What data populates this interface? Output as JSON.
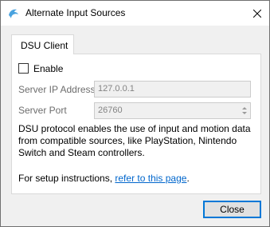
{
  "window": {
    "title": "Alternate Input Sources",
    "app_icon": "dolphin-icon",
    "close_icon": "close-icon"
  },
  "tabs": [
    {
      "label": "DSU Client",
      "active": true
    }
  ],
  "dsu": {
    "enable_label": "Enable",
    "enable_checked": false,
    "server_ip_label": "Server IP Address",
    "server_ip_value": "127.0.0.1",
    "server_port_label": "Server Port",
    "server_port_value": "26760",
    "description": "DSU protocol enables the use of input and motion data from compatible sources, like PlayStation, Nintendo Switch and Steam controllers.",
    "setup_prefix": "For setup instructions, ",
    "setup_link": "refer to this page",
    "setup_suffix": "."
  },
  "footer": {
    "close_label": "Close"
  },
  "colors": {
    "link": "#0066cc",
    "focus_border": "#0078d7",
    "app_icon": "#4aa3df"
  }
}
